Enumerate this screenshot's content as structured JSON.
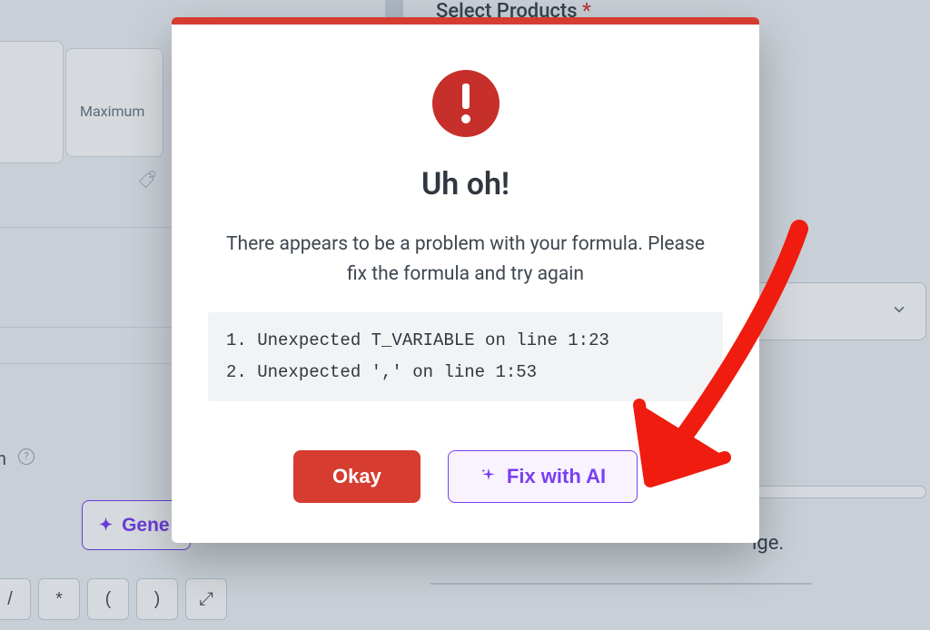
{
  "background": {
    "maximum_label": "Maximum",
    "select_products_label": "Select Products",
    "required_marker": "*",
    "generate_button_label": "Gene",
    "age_fragment": "ige.",
    "n_fragment": "n",
    "help_glyph": "?",
    "operators": [
      "/",
      "*",
      "(",
      ")"
    ],
    "expand_glyph": "⤢"
  },
  "dialog": {
    "title": "Uh oh!",
    "message": "There appears to be a problem with your formula. Please fix the formula and try again",
    "errors": [
      "1. Unexpected T_VARIABLE on line 1:23",
      "2. Unexpected ',' on line 1:53"
    ],
    "okay_label": "Okay",
    "fix_ai_label": "Fix with AI"
  }
}
